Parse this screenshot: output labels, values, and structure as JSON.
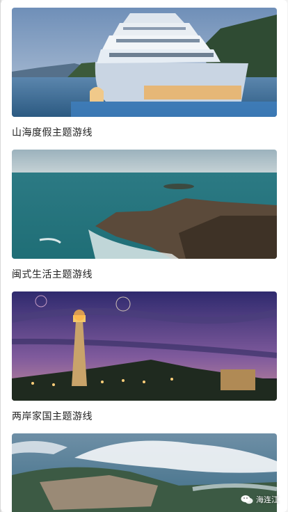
{
  "routes": [
    {
      "caption": "山海度假主题游线",
      "image": "cruise-ship-hotel-coast"
    },
    {
      "caption": "闽式生活主题游线",
      "image": "rocky-island-sea"
    },
    {
      "caption": "两岸家国主题游线",
      "image": "lighthouse-fireworks-night"
    },
    {
      "caption": "",
      "image": "aerial-coastal-town-clouds"
    }
  ],
  "watermark": {
    "label": "海连江",
    "icon": "wechat-icon"
  }
}
